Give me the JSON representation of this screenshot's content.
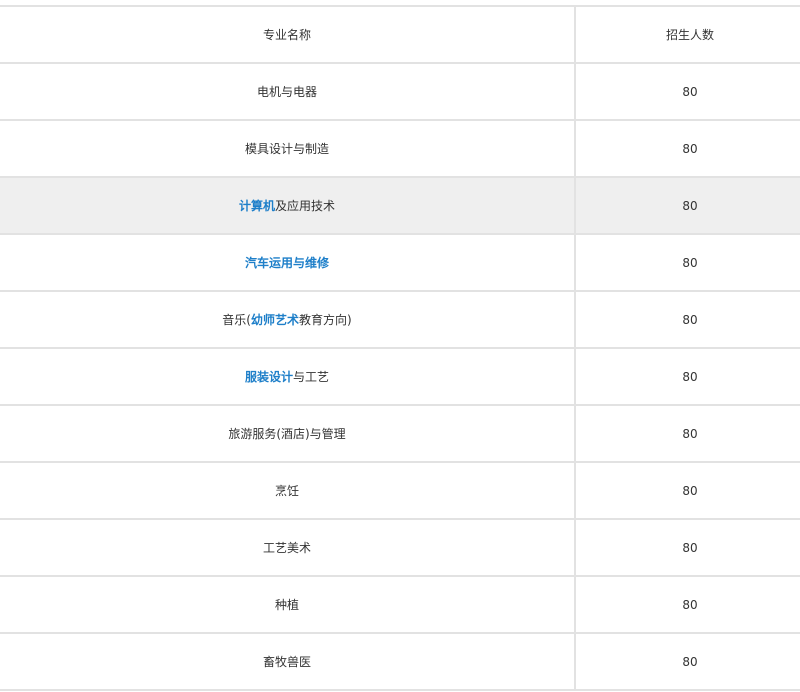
{
  "table": {
    "headers": [
      "专业名称",
      "招生人数"
    ],
    "rows": [
      {
        "name_parts": [
          {
            "text": "电机与电器",
            "link": false
          }
        ],
        "count": "80",
        "highlight": false
      },
      {
        "name_parts": [
          {
            "text": "模具设计与制造",
            "link": false
          }
        ],
        "count": "80",
        "highlight": false
      },
      {
        "name_parts": [
          {
            "text": "计算机",
            "link": true
          },
          {
            "text": "及应用技术",
            "link": false
          }
        ],
        "count": "80",
        "highlight": true
      },
      {
        "name_parts": [
          {
            "text": "汽车运用与维修",
            "link": true
          }
        ],
        "count": "80",
        "highlight": false
      },
      {
        "name_parts": [
          {
            "text": "音乐(",
            "link": false
          },
          {
            "text": "幼师艺术",
            "link": true
          },
          {
            "text": "教育方向)",
            "link": false
          }
        ],
        "count": "80",
        "highlight": false
      },
      {
        "name_parts": [
          {
            "text": "服装设计",
            "link": true
          },
          {
            "text": "与工艺",
            "link": false
          }
        ],
        "count": "80",
        "highlight": false
      },
      {
        "name_parts": [
          {
            "text": "旅游服务(酒店)与管理",
            "link": false
          }
        ],
        "count": "80",
        "highlight": false
      },
      {
        "name_parts": [
          {
            "text": "烹饪",
            "link": false
          }
        ],
        "count": "80",
        "highlight": false
      },
      {
        "name_parts": [
          {
            "text": "工艺美术",
            "link": false
          }
        ],
        "count": "80",
        "highlight": false
      },
      {
        "name_parts": [
          {
            "text": "种植",
            "link": false
          }
        ],
        "count": "80",
        "highlight": false
      },
      {
        "name_parts": [
          {
            "text": "畜牧兽医",
            "link": false
          }
        ],
        "count": "80",
        "highlight": false
      }
    ]
  },
  "colors": {
    "link": "#1e7fc9",
    "border": "#e2e2e2",
    "highlight_row": "#efefef",
    "text": "#333333"
  }
}
